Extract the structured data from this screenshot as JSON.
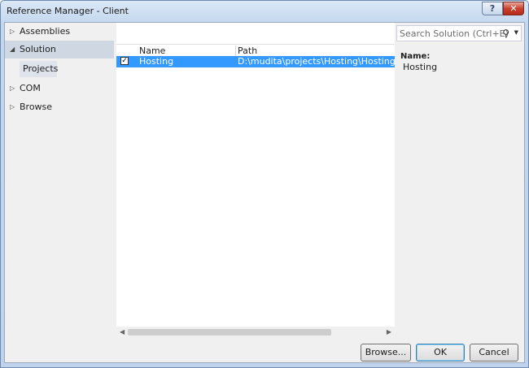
{
  "window": {
    "title": "Reference Manager - Client",
    "help_glyph": "?",
    "close_glyph": "✕"
  },
  "nav": {
    "items": [
      {
        "label": "Assemblies",
        "arrow": "▷"
      },
      {
        "label": "Solution",
        "arrow": "◢"
      },
      {
        "label": "COM",
        "arrow": "▷"
      },
      {
        "label": "Browse",
        "arrow": "▷"
      }
    ],
    "sub_items": [
      {
        "label": "Projects"
      }
    ]
  },
  "list": {
    "columns": [
      "Name",
      "Path"
    ],
    "rows": [
      {
        "checked": true,
        "check_glyph": "✓",
        "name": "Hosting",
        "path": "D:\\mudita\\projects\\Hosting\\Hosting\\Hosting"
      }
    ]
  },
  "search": {
    "placeholder": "Search Solution (Ctrl+E)",
    "icon": "magnifier-icon"
  },
  "details": {
    "label": "Name:",
    "value": "Hosting"
  },
  "buttons": {
    "browse": "Browse...",
    "ok": "OK",
    "cancel": "Cancel"
  }
}
